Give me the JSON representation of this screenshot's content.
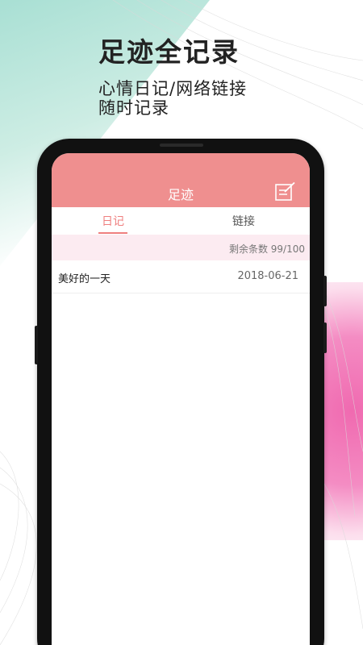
{
  "promo": {
    "headline": "足迹全记录",
    "subline_1": "心情日记/网络链接",
    "subline_2": "随时记录"
  },
  "app": {
    "title": "足迹",
    "edit_icon": "compose-icon",
    "accent_color": "#ef8f8f"
  },
  "tabs": {
    "items": [
      {
        "label": "日记",
        "active": true
      },
      {
        "label": "链接",
        "active": false
      }
    ]
  },
  "quota": {
    "text": "剩余条数 99/100"
  },
  "entries": [
    {
      "title": "美好的一天",
      "date": "2018-06-21"
    }
  ]
}
